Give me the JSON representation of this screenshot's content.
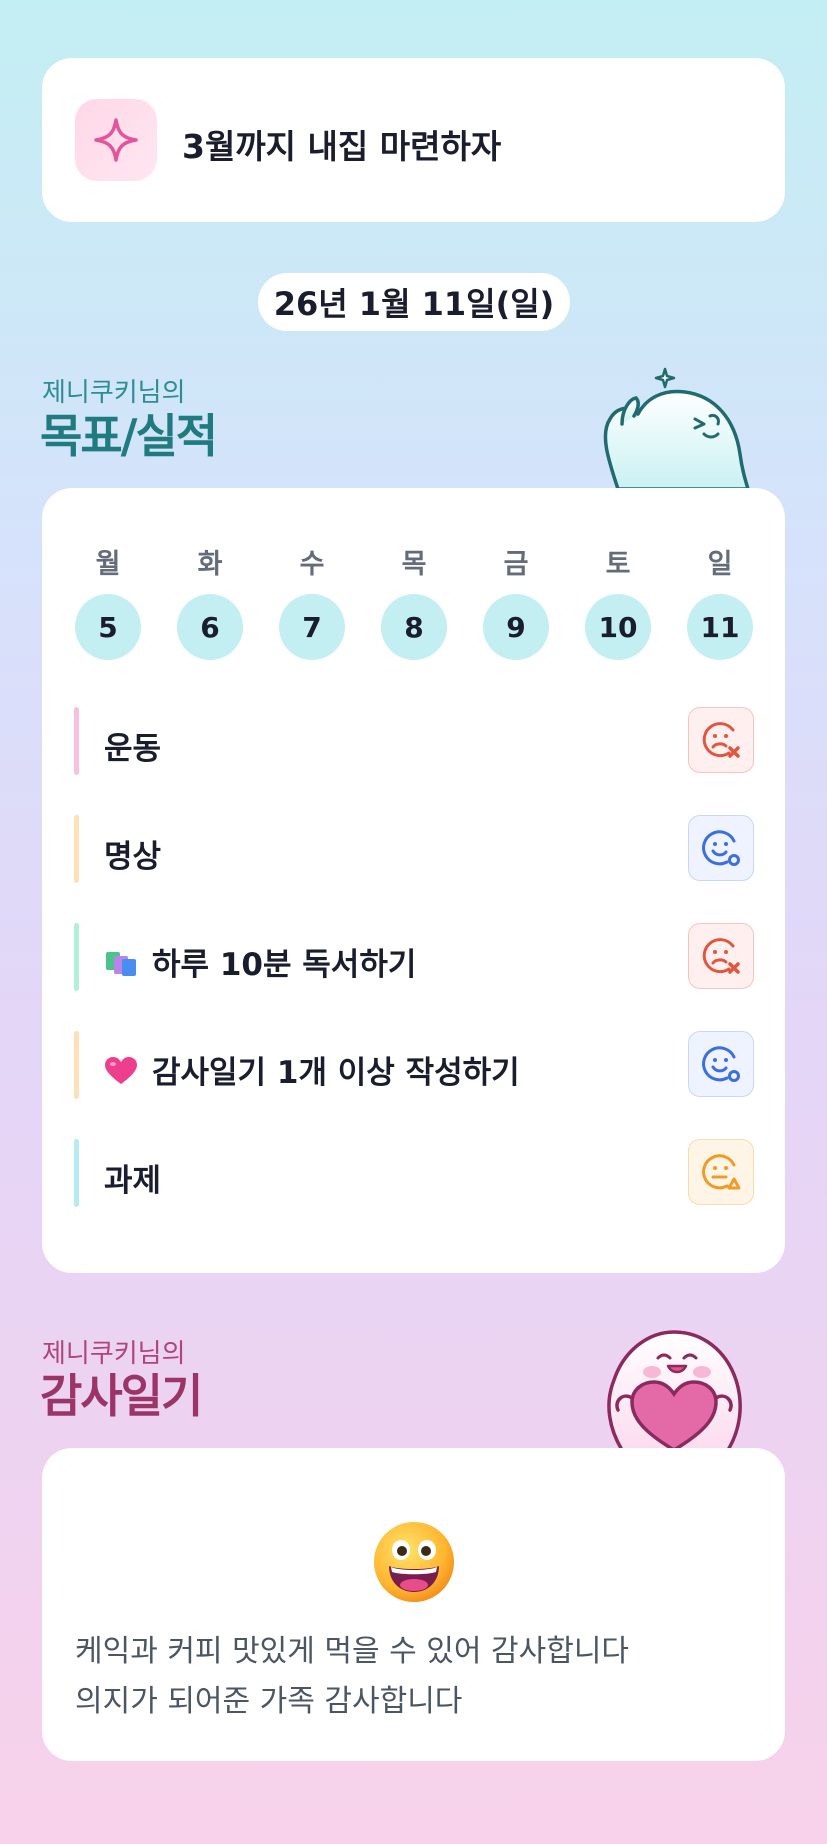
{
  "goal": {
    "text": "3월까지 내집 마련하자",
    "icon": "sparkle-icon"
  },
  "date": "26년 1월 11일(일)",
  "goals_section": {
    "subtitle": "제니쿠키님의",
    "title": "목표/실적"
  },
  "week": {
    "days": [
      {
        "label": "월",
        "date": "5"
      },
      {
        "label": "화",
        "date": "6"
      },
      {
        "label": "수",
        "date": "7"
      },
      {
        "label": "목",
        "date": "8"
      },
      {
        "label": "금",
        "date": "9"
      },
      {
        "label": "토",
        "date": "10"
      },
      {
        "label": "일",
        "date": "11"
      }
    ]
  },
  "habits": [
    {
      "label": "운동",
      "emoji": "",
      "status": "fail",
      "bar_color": "#f8bfe0"
    },
    {
      "label": "명상",
      "emoji": "",
      "status": "ok",
      "bar_color": "#fbe0b8"
    },
    {
      "label": "하루 10분 독서하기",
      "emoji": "books-icon",
      "status": "fail",
      "bar_color": "#b3efd5"
    },
    {
      "label": "감사일기 1개 이상 작성하기",
      "emoji": "heart-icon",
      "status": "ok",
      "bar_color": "#fbe0b8"
    },
    {
      "label": "과제",
      "emoji": "",
      "status": "mid",
      "bar_color": "#b7eaf2"
    }
  ],
  "status_colors": {
    "fail": "#e2553f",
    "ok": "#3a6fe0",
    "mid": "#f29a26"
  },
  "gratitude_section": {
    "subtitle": "제니쿠키님의",
    "title": "감사일기"
  },
  "gratitude": {
    "emoji": "grinning-face-icon",
    "lines": [
      "케익과 커피 맛있게 먹을 수 있어 감사합니다",
      "의지가 되어준 가족 감사합니다"
    ]
  }
}
